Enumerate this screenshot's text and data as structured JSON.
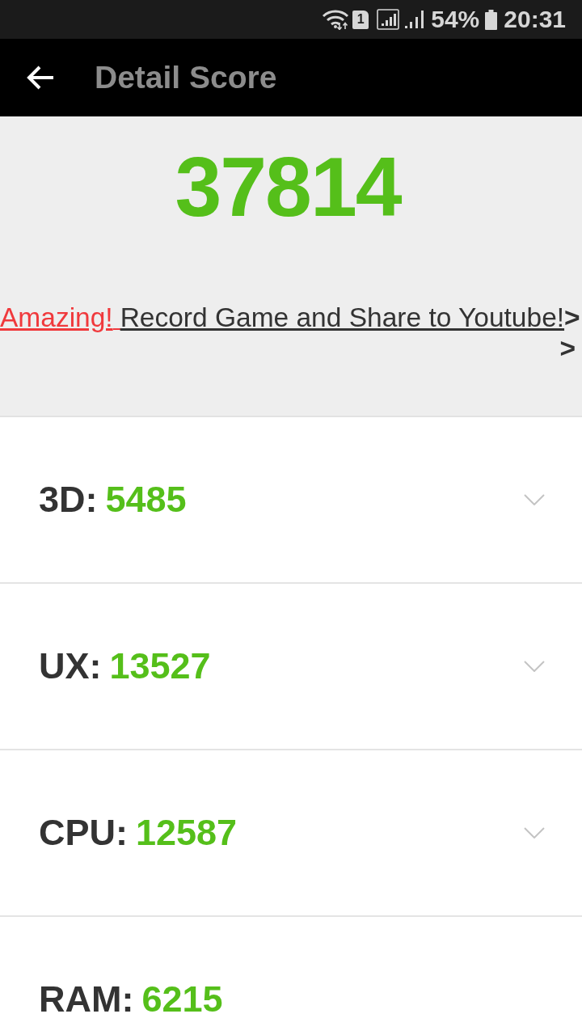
{
  "status_bar": {
    "sim_slot": "1",
    "battery": "54%",
    "time": "20:31"
  },
  "app_bar": {
    "title": "Detail Score"
  },
  "total": {
    "score": "37814"
  },
  "promo": {
    "highlight": "Amazing!",
    "link": "Record Game and Share to Youtube!",
    "arrows": [
      ">",
      ">"
    ]
  },
  "categories": [
    {
      "label": "3D:",
      "score": "5485",
      "expandable": true,
      "expanded": false
    },
    {
      "label": "UX:",
      "score": "13527",
      "expandable": true,
      "expanded": false
    },
    {
      "label": "CPU:",
      "score": "12587",
      "expandable": true,
      "expanded": false
    },
    {
      "label": "RAM:",
      "score": "6215",
      "expandable": false
    }
  ]
}
